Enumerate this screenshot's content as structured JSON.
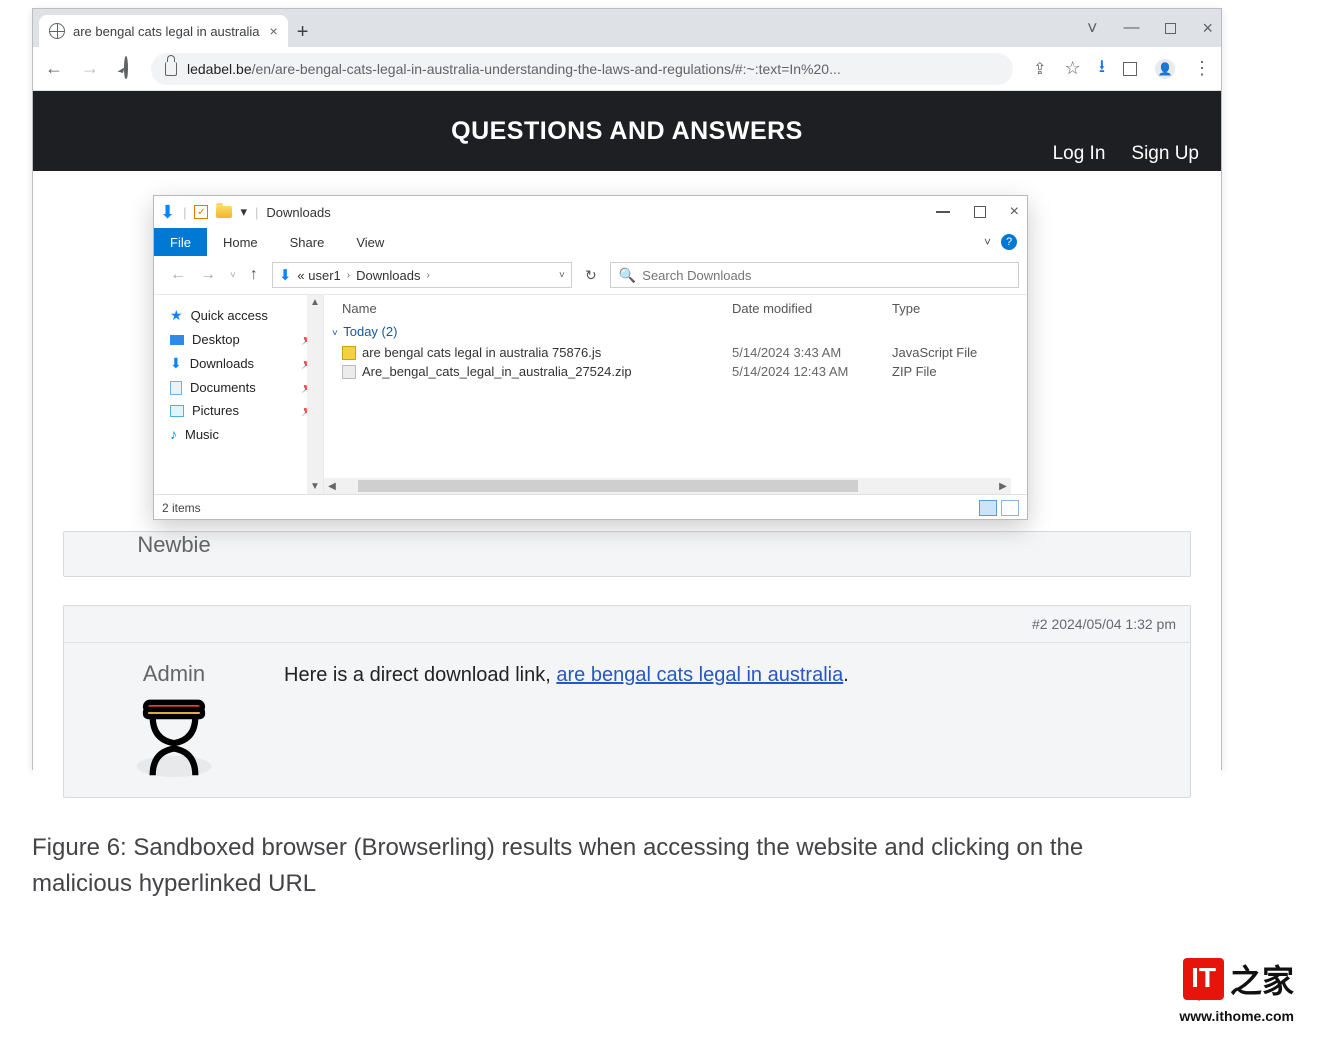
{
  "browser": {
    "tab_title": "are bengal cats legal in australia",
    "url_host": "ledabel.be",
    "url_path": "/en/are-bengal-cats-legal-in-australia-understanding-the-laws-and-regulations/#:~:text=In%20...",
    "window_controls": {
      "minimize": "—",
      "maximize": "□",
      "close": "×"
    }
  },
  "page": {
    "hero_title": "QUESTIONS AND ANSWERS",
    "login": "Log In",
    "signup": "Sign Up",
    "newbie_label": "Newbie",
    "post2": {
      "stamp": "#2 2024/05/04 1:32 pm",
      "author": "Admin",
      "text_before_link": "Here is a direct download link, ",
      "link_text": "are bengal cats legal in australia",
      "text_after_link": "."
    }
  },
  "explorer": {
    "title": "Downloads",
    "ribbon_tabs": [
      "File",
      "Home",
      "Share",
      "View"
    ],
    "path_left_label": "« user1",
    "path_child": "Downloads",
    "search_placeholder": "Search Downloads",
    "columns": {
      "name": "Name",
      "date": "Date modified",
      "type": "Type"
    },
    "group_label": "Today (2)",
    "files": [
      {
        "name": "are bengal cats legal in australia 75876.js",
        "date": "5/14/2024 3:43 AM",
        "type": "JavaScript File",
        "icon": "js"
      },
      {
        "name": "Are_bengal_cats_legal_in_australia_27524.zip",
        "date": "5/14/2024 12:43 AM",
        "type": "ZIP File",
        "icon": "zip"
      }
    ],
    "sidebar": [
      {
        "label": "Quick access",
        "icon": "star",
        "pinned": false
      },
      {
        "label": "Desktop",
        "icon": "desk",
        "pinned": true
      },
      {
        "label": "Downloads",
        "icon": "dn",
        "pinned": true
      },
      {
        "label": "Documents",
        "icon": "doc",
        "pinned": true
      },
      {
        "label": "Pictures",
        "icon": "pic",
        "pinned": true
      },
      {
        "label": "Music",
        "icon": "mus",
        "pinned": false
      }
    ],
    "status": "2 items"
  },
  "caption": "Figure 6:  Sandboxed browser (Browserling) results when accessing the website and clicking on the malicious hyperlinked URL",
  "watermark": {
    "box": "IT",
    "cn": "之家",
    "url": "www.ithome.com"
  }
}
